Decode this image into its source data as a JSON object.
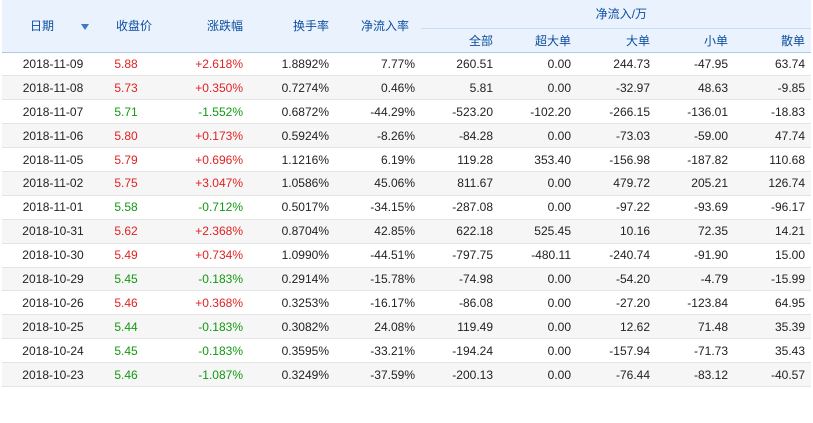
{
  "headers": {
    "date": "日期",
    "close": "收盘价",
    "change": "涨跌幅",
    "turnover": "换手率",
    "net_inflow_rate": "净流入率",
    "net_inflow_group": "净流入/万",
    "all": "全部",
    "xl": "超大单",
    "large": "大单",
    "small": "小单",
    "retail": "散单"
  },
  "colors": {
    "up": "#e02222",
    "down": "#119911",
    "header_bg": "#eaf2fd",
    "header_text": "#0d4fa0"
  },
  "rows": [
    {
      "date": "2018-11-09",
      "close": "5.88",
      "change": "+2.618%",
      "turnover": "1.8892%",
      "rate": "7.77%",
      "all": "260.51",
      "xl": "0.00",
      "large": "244.73",
      "small": "-47.95",
      "retail": "63.74",
      "dir": "up"
    },
    {
      "date": "2018-11-08",
      "close": "5.73",
      "change": "+0.350%",
      "turnover": "0.7274%",
      "rate": "0.46%",
      "all": "5.81",
      "xl": "0.00",
      "large": "-32.97",
      "small": "48.63",
      "retail": "-9.85",
      "dir": "up"
    },
    {
      "date": "2018-11-07",
      "close": "5.71",
      "change": "-1.552%",
      "turnover": "0.6872%",
      "rate": "-44.29%",
      "all": "-523.20",
      "xl": "-102.20",
      "large": "-266.15",
      "small": "-136.01",
      "retail": "-18.83",
      "dir": "down"
    },
    {
      "date": "2018-11-06",
      "close": "5.80",
      "change": "+0.173%",
      "turnover": "0.5924%",
      "rate": "-8.26%",
      "all": "-84.28",
      "xl": "0.00",
      "large": "-73.03",
      "small": "-59.00",
      "retail": "47.74",
      "dir": "up"
    },
    {
      "date": "2018-11-05",
      "close": "5.79",
      "change": "+0.696%",
      "turnover": "1.1216%",
      "rate": "6.19%",
      "all": "119.28",
      "xl": "353.40",
      "large": "-156.98",
      "small": "-187.82",
      "retail": "110.68",
      "dir": "up"
    },
    {
      "date": "2018-11-02",
      "close": "5.75",
      "change": "+3.047%",
      "turnover": "1.0586%",
      "rate": "45.06%",
      "all": "811.67",
      "xl": "0.00",
      "large": "479.72",
      "small": "205.21",
      "retail": "126.74",
      "dir": "up"
    },
    {
      "date": "2018-11-01",
      "close": "5.58",
      "change": "-0.712%",
      "turnover": "0.5017%",
      "rate": "-34.15%",
      "all": "-287.08",
      "xl": "0.00",
      "large": "-97.22",
      "small": "-93.69",
      "retail": "-96.17",
      "dir": "down"
    },
    {
      "date": "2018-10-31",
      "close": "5.62",
      "change": "+2.368%",
      "turnover": "0.8704%",
      "rate": "42.85%",
      "all": "622.18",
      "xl": "525.45",
      "large": "10.16",
      "small": "72.35",
      "retail": "14.21",
      "dir": "up"
    },
    {
      "date": "2018-10-30",
      "close": "5.49",
      "change": "+0.734%",
      "turnover": "1.0990%",
      "rate": "-44.51%",
      "all": "-797.75",
      "xl": "-480.11",
      "large": "-240.74",
      "small": "-91.90",
      "retail": "15.00",
      "dir": "up"
    },
    {
      "date": "2018-10-29",
      "close": "5.45",
      "change": "-0.183%",
      "turnover": "0.2914%",
      "rate": "-15.78%",
      "all": "-74.98",
      "xl": "0.00",
      "large": "-54.20",
      "small": "-4.79",
      "retail": "-15.99",
      "dir": "down"
    },
    {
      "date": "2018-10-26",
      "close": "5.46",
      "change": "+0.368%",
      "turnover": "0.3253%",
      "rate": "-16.17%",
      "all": "-86.08",
      "xl": "0.00",
      "large": "-27.20",
      "small": "-123.84",
      "retail": "64.95",
      "dir": "up"
    },
    {
      "date": "2018-10-25",
      "close": "5.44",
      "change": "-0.183%",
      "turnover": "0.3082%",
      "rate": "24.08%",
      "all": "119.49",
      "xl": "0.00",
      "large": "12.62",
      "small": "71.48",
      "retail": "35.39",
      "dir": "down"
    },
    {
      "date": "2018-10-24",
      "close": "5.45",
      "change": "-0.183%",
      "turnover": "0.3595%",
      "rate": "-33.21%",
      "all": "-194.24",
      "xl": "0.00",
      "large": "-157.94",
      "small": "-71.73",
      "retail": "35.43",
      "dir": "down"
    },
    {
      "date": "2018-10-23",
      "close": "5.46",
      "change": "-1.087%",
      "turnover": "0.3249%",
      "rate": "-37.59%",
      "all": "-200.13",
      "xl": "0.00",
      "large": "-76.44",
      "small": "-83.12",
      "retail": "-40.57",
      "dir": "down"
    }
  ]
}
